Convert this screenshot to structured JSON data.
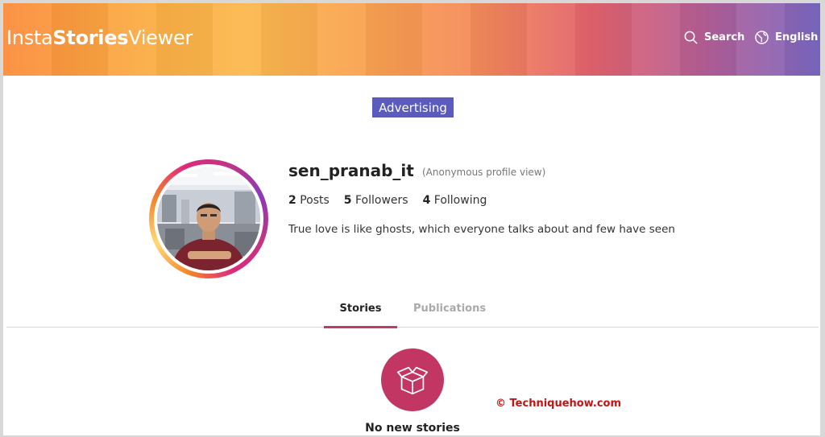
{
  "header": {
    "logo": {
      "part1": "Insta",
      "part2": "Stories",
      "part3": "Viewer"
    },
    "search_label": "Search",
    "language_label": "English"
  },
  "ad": {
    "label": "Advertising"
  },
  "profile": {
    "username": "sen_pranab_it",
    "view_mode": "(Anonymous profile view)",
    "posts_count": "2",
    "posts_label": "Posts",
    "followers_count": "5",
    "followers_label": "Followers",
    "following_count": "4",
    "following_label": "Following",
    "bio": "True love is like ghosts, which everyone talks about and few have seen"
  },
  "tabs": [
    {
      "label": "Stories",
      "active": true
    },
    {
      "label": "Publications",
      "active": false
    }
  ],
  "empty_state": {
    "icon": "open-box-icon",
    "text": "No new stories"
  },
  "watermark": "© Techniquehow.com",
  "colors": {
    "accent": "#c13663",
    "ad_background": "#5b5bbd",
    "tab_underline": "#c13a6c",
    "watermark": "#c41313"
  }
}
